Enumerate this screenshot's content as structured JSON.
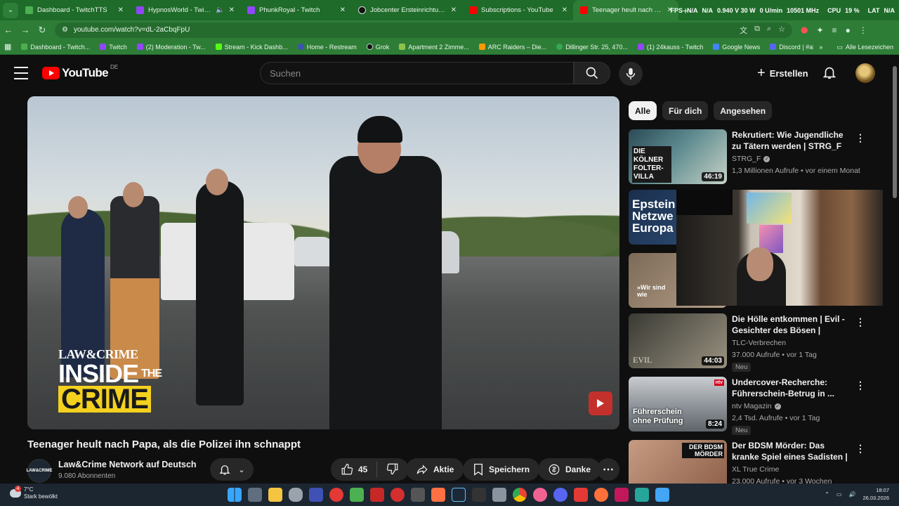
{
  "browser": {
    "tabs": [
      {
        "title": "Dashboard - TwitchTTS",
        "color": "#4caf50"
      },
      {
        "title": "HypnosWorld - Twitch",
        "color": "#9146ff",
        "muted": true
      },
      {
        "title": "PhunkRoyal - Twitch",
        "color": "#9146ff"
      },
      {
        "title": "Jobcenter Ersteinrichtung: Betr...",
        "color": "#111111"
      },
      {
        "title": "Subscriptions - YouTube",
        "color": "#ff0000"
      },
      {
        "title": "Teenager heult nach Papa...",
        "color": "#ff0000",
        "active": true
      }
    ],
    "hud": {
      "fps_label": "FPS",
      "fps": "N/A",
      "gpu": "N/A",
      "power": "0.940 V 30 W",
      "rpm": "0 U/min",
      "mhz": "10501 MHz",
      "cpu_label": "CPU",
      "cpu": "19 %",
      "lat_label": "LAT",
      "lat": "N/A"
    },
    "url": "youtube.com/watch?v=dL-2aCbqFpU",
    "bookmarks": [
      {
        "label": "Dashboard - Twitch...",
        "color": "#4caf50"
      },
      {
        "label": "Twitch",
        "color": "#9146ff"
      },
      {
        "label": "(2) Moderation - Tw...",
        "color": "#9146ff"
      },
      {
        "label": "Stream - Kick Dashb...",
        "color": "#53fc18"
      },
      {
        "label": "Home - Restream",
        "color": "#3f51b5"
      },
      {
        "label": "Grok",
        "color": "#111111"
      },
      {
        "label": "Apartment 2 Zimme...",
        "color": "#8bc34a"
      },
      {
        "label": "ARC Raiders – Die...",
        "color": "#ff9800"
      },
      {
        "label": "Dillinger Str. 25, 470...",
        "color": "#34a853"
      },
      {
        "label": "(1) 24kauss - Twitch",
        "color": "#9146ff"
      },
      {
        "label": "Google News",
        "color": "#4285f4"
      },
      {
        "label": "Discord | #allgeme...",
        "color": "#5865f2"
      }
    ],
    "bookmarks_all": "Alle Lesezeichen"
  },
  "youtube": {
    "country": "DE",
    "logo_text": "YouTube",
    "search_placeholder": "Suchen",
    "create_label": "Erstellen",
    "video": {
      "title": "Teenager heult nach Papa, als die Polizei ihn schnappt",
      "brand_line1": "LAW&CRIME",
      "brand_line2": "INSIDE",
      "brand_the": "THE",
      "brand_line3": "CRIME",
      "channel": "Law&Crime Network auf Deutsch",
      "channel_avatar_text": "LAW&CRIME",
      "subscribers": "9.080 Abonnenten",
      "likes": "45",
      "share_label": "Aktie",
      "save_label": "Speichern",
      "thanks_label": "Danke"
    },
    "chips": [
      "Alle",
      "Für dich",
      "Angesehen"
    ],
    "recommendations": [
      {
        "title": "Rekrutiert: Wie Jugendliche zu Tätern werden | STRG_F",
        "channel": "STRG_F",
        "verified": true,
        "meta": "1,3 Millionen Aufrufe • vor einem Monat",
        "duration": "46:19",
        "thumb_text": "DIE KÖLNER FOLTER-VILLA"
      },
      {
        "title": "Epstein Netzwerk Europa",
        "channel": "",
        "verified": false,
        "meta": "",
        "duration": "",
        "thumb_text": "Epstein Netzwe Europa"
      },
      {
        "title": "",
        "channel": "",
        "verified": false,
        "meta": "",
        "duration": "",
        "thumb_text": "»Wir sind wie"
      },
      {
        "title": "Die Hölle entkommen | Evil - Gesichter des Bösen | GANZE ...",
        "channel": "TLC-Verbrechen",
        "verified": false,
        "meta": "37.000 Aufrufe • vor 1 Tag",
        "duration": "44:03",
        "badge": "Neu",
        "thumb_text": "EVIL"
      },
      {
        "title": "Undercover-Recherche: Führerschein-Betrug in ...",
        "channel": "ntv Magazin",
        "verified": true,
        "meta": "2,4 Tsd. Aufrufe • vor 1 Tag",
        "duration": "8:24",
        "badge": "Neu",
        "thumb_text": "Führerschein ohne Prüfung"
      },
      {
        "title": "Der BDSM Mörder: Das kranke Spiel eines Sadisten | True-...",
        "channel": "XL True Crime",
        "verified": false,
        "meta": "23.000 Aufrufe • vor 3 Wochen",
        "duration": "",
        "thumb_text": "DER BDSM MÖRDER"
      }
    ]
  },
  "taskbar": {
    "weather_temp": "7°C",
    "weather_desc": "Stark bewölkt",
    "notif_count": "4",
    "time": "18:07",
    "date": "26.03.2026"
  }
}
